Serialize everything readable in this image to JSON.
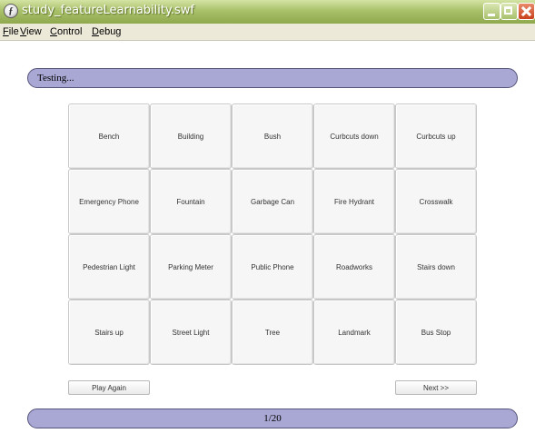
{
  "window": {
    "title": "study_featureLearnability.swf"
  },
  "menu": [
    {
      "label_first": "F",
      "label_rest": "ile"
    },
    {
      "label_first": "V",
      "label_rest": "iew"
    },
    {
      "label_first": "C",
      "label_rest": "ontrol"
    },
    {
      "label_first": "D",
      "label_rest": "ebug"
    }
  ],
  "status": {
    "text": "Testing..."
  },
  "features": [
    "Bench",
    "Building",
    "Bush",
    "Curbcuts down",
    "Curbcuts up",
    "Emergency Phone",
    "Fountain",
    "Garbage Can",
    "Fire Hydrant",
    "Crosswalk",
    "Pedestrian Light",
    "Parking Meter",
    "Public Phone",
    "Roadworks",
    "Stairs down",
    "Stairs up",
    "Street Light",
    "Tree",
    "Landmark",
    "Bus Stop"
  ],
  "buttons": {
    "play_again": "Play Again",
    "next": "Next >>"
  },
  "progress": {
    "text": "1/20"
  },
  "colors": {
    "titlebar": "#a9c16a",
    "pill": "#a9a7d3",
    "close": "#c9401c"
  }
}
